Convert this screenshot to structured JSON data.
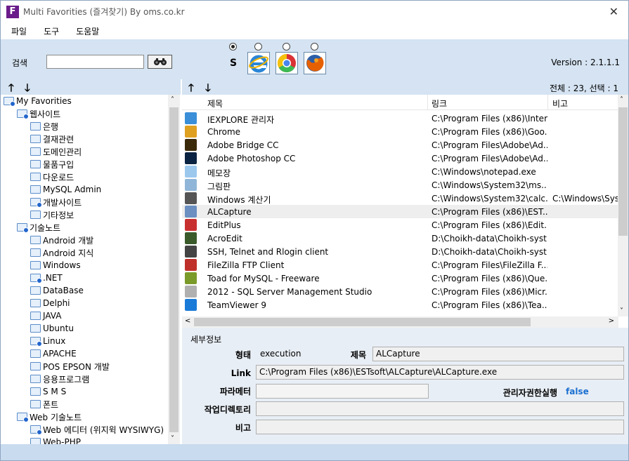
{
  "window": {
    "title": "Multi Favorities (즐겨찾기) By oms.co.kr",
    "app_icon": "F",
    "close_glyph": "✕"
  },
  "menu": [
    "파일",
    "도구",
    "도움말"
  ],
  "toolbar": {
    "search_label": "검색",
    "search_value": "",
    "search_button_icon": "binoculars-icon",
    "browser_s_label": "S",
    "version": "Version : 2.1.1.1",
    "browsers": [
      "internet-explorer-icon",
      "chrome-icon",
      "firefox-icon"
    ],
    "selected_radio": "S"
  },
  "nav": {
    "up": "🡑",
    "down": "🡓"
  },
  "list_status": "전체 : 23, 선택 : 1",
  "tree": [
    {
      "label": "My Favorities",
      "level": 0,
      "badge": true
    },
    {
      "label": "웹사이트",
      "level": 1,
      "badge": true
    },
    {
      "label": "은행",
      "level": 2,
      "badge": false
    },
    {
      "label": "결재관련",
      "level": 2,
      "badge": false
    },
    {
      "label": "도메인관리",
      "level": 2,
      "badge": false
    },
    {
      "label": "물품구입",
      "level": 2,
      "badge": false
    },
    {
      "label": "다운로드",
      "level": 2,
      "badge": false
    },
    {
      "label": "MySQL Admin",
      "level": 2,
      "badge": false
    },
    {
      "label": "개발사이트",
      "level": 2,
      "badge": true
    },
    {
      "label": "기타정보",
      "level": 2,
      "badge": false
    },
    {
      "label": "기술노트",
      "level": 1,
      "badge": true
    },
    {
      "label": "Android 개발",
      "level": 2,
      "badge": false
    },
    {
      "label": "Android 지식",
      "level": 2,
      "badge": false
    },
    {
      "label": "Windows",
      "level": 2,
      "badge": false
    },
    {
      "label": ".NET",
      "level": 2,
      "badge": true
    },
    {
      "label": "DataBase",
      "level": 2,
      "badge": false
    },
    {
      "label": "Delphi",
      "level": 2,
      "badge": false
    },
    {
      "label": "JAVA",
      "level": 2,
      "badge": false
    },
    {
      "label": "Ubuntu",
      "level": 2,
      "badge": false
    },
    {
      "label": "Linux",
      "level": 2,
      "badge": true
    },
    {
      "label": "APACHE",
      "level": 2,
      "badge": false
    },
    {
      "label": "POS EPSON 개발",
      "level": 2,
      "badge": false
    },
    {
      "label": "응용프로그램",
      "level": 2,
      "badge": false
    },
    {
      "label": "S M S",
      "level": 2,
      "badge": false
    },
    {
      "label": "폰트",
      "level": 2,
      "badge": false
    },
    {
      "label": "Web 기술노트",
      "level": 1,
      "badge": true
    },
    {
      "label": "Web 에디터 (위지윅 WYSIWYG)",
      "level": 2,
      "badge": true
    },
    {
      "label": "Web-PHP",
      "level": 2,
      "badge": false
    }
  ],
  "list": {
    "headers": [
      "제목",
      "링크",
      "비고"
    ],
    "rows": [
      {
        "title": "IEXPLORE 관리자",
        "link": "C:\\Program Files (x86)\\Inter...",
        "note": "",
        "icon": "ie-icon",
        "color": "#3a8fd8",
        "selected": false
      },
      {
        "title": "Chrome",
        "link": "C:\\Program Files (x86)\\Goo...",
        "note": "",
        "icon": "chrome-icon",
        "color": "#e0a020",
        "selected": false
      },
      {
        "title": "Adobe Bridge CC",
        "link": "C:\\Program Files\\Adobe\\Ad...",
        "note": "",
        "icon": "bridge-icon",
        "color": "#3b2a0a",
        "selected": false
      },
      {
        "title": "Adobe Photoshop CC",
        "link": "C:\\Program Files\\Adobe\\Ad...",
        "note": "",
        "icon": "photoshop-icon",
        "color": "#0b2342",
        "selected": false
      },
      {
        "title": "메모장",
        "link": "C:\\Windows\\notepad.exe",
        "note": "",
        "icon": "notepad-icon",
        "color": "#9cc8ee",
        "selected": false
      },
      {
        "title": "그림판",
        "link": "C:\\Windows\\System32\\ms...",
        "note": "",
        "icon": "paint-icon",
        "color": "#8fb6d8",
        "selected": false
      },
      {
        "title": "Windows 계산기",
        "link": "C:\\Windows\\System32\\calc...",
        "note": "C:\\Windows\\Syst",
        "icon": "calculator-icon",
        "color": "#555555",
        "selected": false
      },
      {
        "title": "ALCapture",
        "link": "C:\\Program Files (x86)\\EST...",
        "note": "",
        "icon": "alcapture-icon",
        "color": "#6a8fc0",
        "selected": true
      },
      {
        "title": "EditPlus",
        "link": "C:\\Program Files (x86)\\Edit...",
        "note": "",
        "icon": "editplus-icon",
        "color": "#c83030",
        "selected": false
      },
      {
        "title": "AcroEdit",
        "link": "D:\\Choikh-data\\Choikh-syst...",
        "note": "",
        "icon": "acroedit-icon",
        "color": "#3a5a2a",
        "selected": false
      },
      {
        "title": "SSH, Telnet and Rlogin client",
        "link": "D:\\Choikh-data\\Choikh-syst...",
        "note": "",
        "icon": "ssh-icon",
        "color": "#444444",
        "selected": false
      },
      {
        "title": "FileZilla FTP Client",
        "link": "C:\\Program Files\\FileZilla F...",
        "note": "",
        "icon": "filezilla-icon",
        "color": "#c0302a",
        "selected": false
      },
      {
        "title": "Toad for MySQL - Freeware",
        "link": "C:\\Program Files (x86)\\Que...",
        "note": "",
        "icon": "toad-icon",
        "color": "#7a9a2a",
        "selected": false
      },
      {
        "title": "2012 - SQL Server Management Studio",
        "link": "C:\\Program Files (x86)\\Micr...",
        "note": "",
        "icon": "sqlserver-icon",
        "color": "#b0b0b0",
        "selected": false
      },
      {
        "title": "TeamViewer 9",
        "link": "C:\\Program Files (x86)\\Tea...",
        "note": "",
        "icon": "teamviewer-icon",
        "color": "#1a7ad8",
        "selected": false
      }
    ]
  },
  "detail": {
    "section_title": "세부정보",
    "type_label": "형태",
    "type_value": "execution",
    "title_label": "제목",
    "title_value": "ALCapture",
    "link_label": "Link",
    "link_value": "C:\\Program Files (x86)\\ESTsoft\\ALCapture\\ALCapture.exe",
    "param_label": "파라메터",
    "param_value": "",
    "admin_label": "관리자권한실행",
    "admin_value": "false",
    "workdir_label": "작업디렉토리",
    "workdir_value": "",
    "note_label": "비고",
    "note_value": ""
  },
  "colors": {
    "admin_value": "#1a6fd1",
    "toolbar_bg": "#d5e3f2",
    "selected_row": "#eeeeee"
  }
}
